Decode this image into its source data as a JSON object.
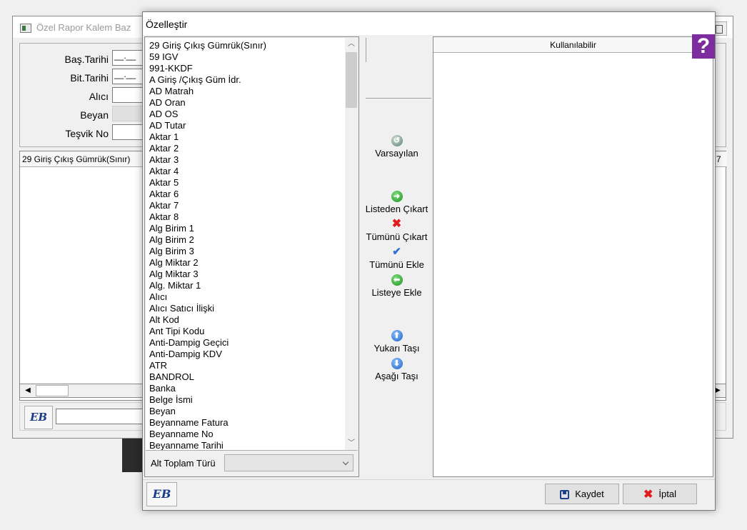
{
  "background_window": {
    "title": "Özel Rapor Kalem Baz",
    "fields": [
      {
        "label": "Baş.Tarihi",
        "value": "__.__"
      },
      {
        "label": "Bit.Tarihi",
        "value": "__.__"
      },
      {
        "label": "Alıcı",
        "value": ""
      },
      {
        "label": "Beyan",
        "value": ""
      },
      {
        "label": "Teşvik No",
        "value": ""
      }
    ],
    "grid_first_column": "29 Giriş Çıkış Gümrük(Sınır)",
    "grid_last_col_fragment": "7",
    "logo_text": "EB"
  },
  "dialog": {
    "title": "Özelleştir",
    "field_list": [
      "29 Giriş Çıkış Gümrük(Sınır)",
      "59 IGV",
      "991-KKDF",
      "A Giriş /Çıkış Güm İdr.",
      "AD Matrah",
      "AD Oran",
      "AD OS",
      "AD Tutar",
      "Aktar 1",
      "Aktar 2",
      "Aktar 3",
      "Aktar 4",
      "Aktar 5",
      "Aktar 6",
      "Aktar 7",
      "Aktar 8",
      "Alg Birim 1",
      "Alg Birim 2",
      "Alg Birim 3",
      "Alg Miktar 2",
      "Alg Miktar 3",
      "Alg. Miktar 1",
      "Alıcı",
      "Alıcı Satıcı İlişki",
      "Alt Kod",
      "Ant Tipi Kodu",
      "Anti-Dampig Geçici",
      "Anti-Dampig KDV",
      "ATR",
      "BANDROL",
      "Banka",
      "Belge İsmi",
      "Beyan",
      "Beyanname Fatura",
      "Beyanname No",
      "Beyanname Tarihi"
    ],
    "subtotal_label": "Alt Toplam Türü",
    "subtotal_value": "",
    "actions": {
      "defaults": "Varsayılan",
      "remove_from_list": "Listeden Çıkart",
      "remove_all": "Tümünü Çıkart",
      "add_all": "Tümünü Ekle",
      "add_to_list": "Listeye Ekle",
      "move_up": "Yukarı Taşı",
      "move_down": "Aşağı Taşı"
    },
    "available_header": "Kullanılabilir",
    "help_glyph": "?",
    "logo_text": "EB",
    "save_label": "Kaydet",
    "cancel_label": "İptal"
  },
  "colors": {
    "help_bg": "#7c2c9c",
    "cancel_icon": "#e01c1c",
    "save_icon": "#1e3f8a"
  },
  "icons": [
    "app-icon",
    "help-icon",
    "defaults-icon",
    "arrow-right-icon",
    "x-icon",
    "checkmark-icon",
    "arrow-left-icon",
    "arrow-up-icon",
    "arrow-down-icon",
    "save-icon",
    "cancel-icon",
    "eb-logo-icon"
  ]
}
